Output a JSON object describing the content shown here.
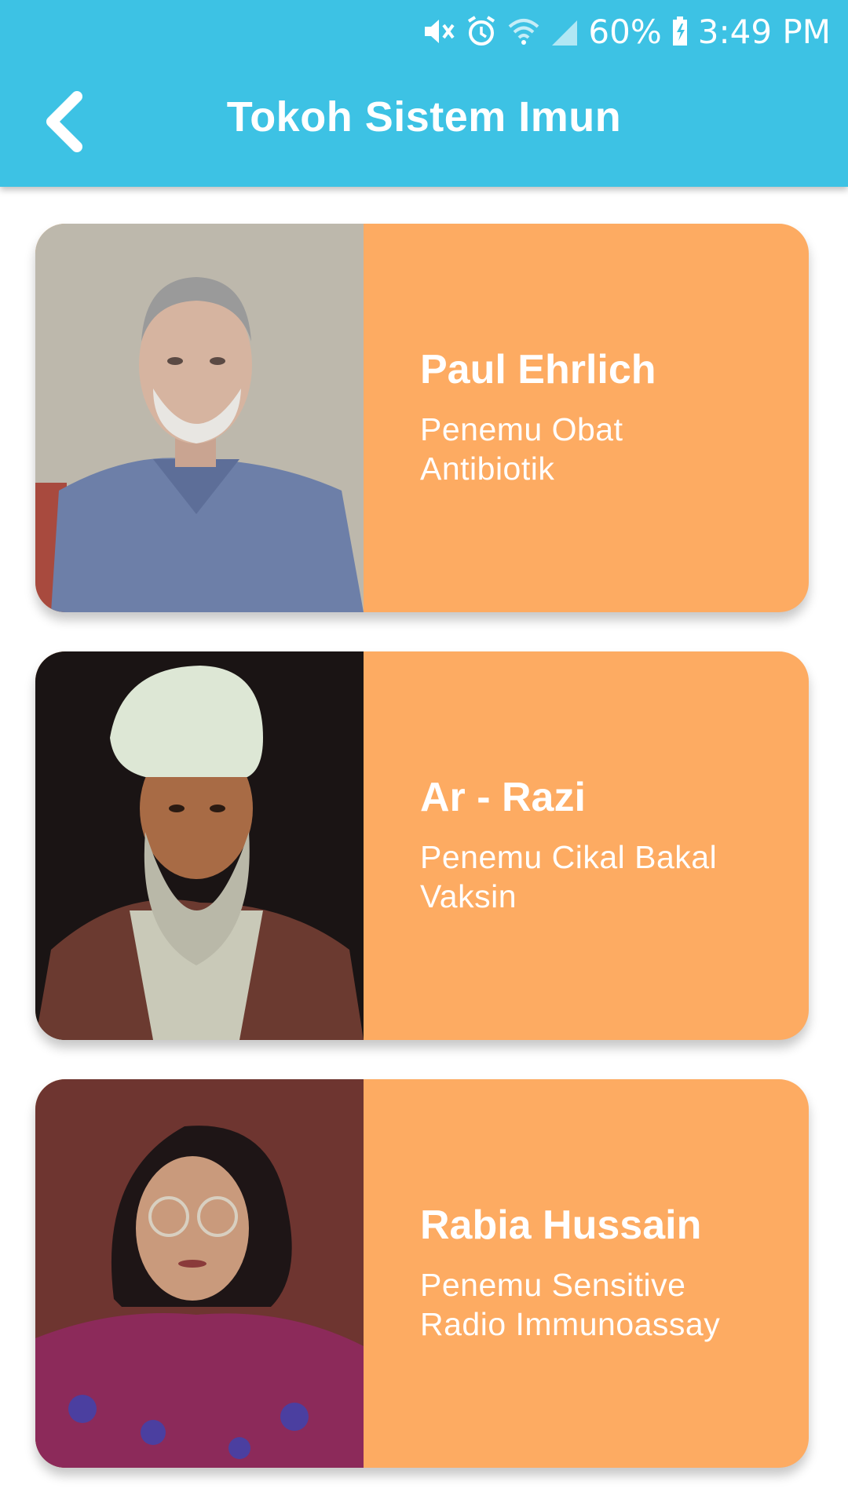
{
  "status_bar": {
    "battery": "60%",
    "time": "3:49 PM",
    "icons": [
      "mute-icon",
      "alarm-icon",
      "wifi-icon",
      "signal-icon",
      "battery-charging-icon"
    ]
  },
  "app_bar": {
    "title": "Tokoh Sistem Imun",
    "back_icon": "chevron-left-icon"
  },
  "colors": {
    "app_bar": "#3dc2e4",
    "card": "#fdab62",
    "text_on_color": "#ffffff"
  },
  "figures": [
    {
      "name": "Paul Ehrlich",
      "description_line1": "Penemu Obat",
      "description_line2": "Antibiotik"
    },
    {
      "name": "Ar - Razi",
      "description_line1": "Penemu Cikal Bakal",
      "description_line2": "Vaksin"
    },
    {
      "name": "Rabia Hussain",
      "description_line1": "Penemu Sensitive",
      "description_line2": "Radio Immunoassay"
    }
  ]
}
